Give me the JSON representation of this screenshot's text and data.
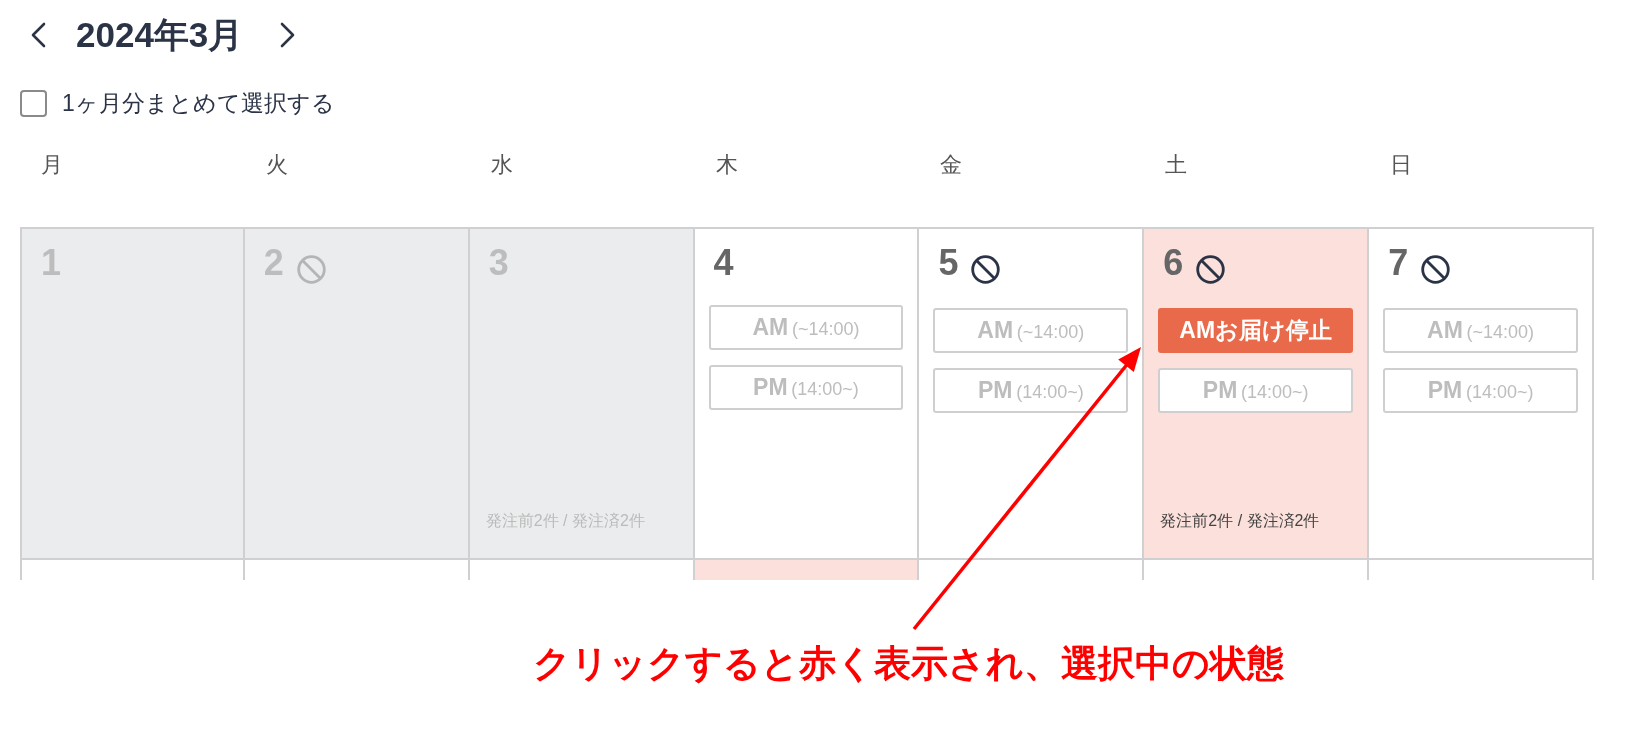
{
  "header": {
    "title": "2024年3月"
  },
  "select_month": {
    "label": "1ヶ月分まとめて選択する",
    "checked": false
  },
  "weekdays": [
    "月",
    "火",
    "水",
    "木",
    "金",
    "土",
    "日"
  ],
  "weeks": [
    {
      "days": [
        {
          "number": "1",
          "disabled": true,
          "selected": false,
          "no_delivery": false
        },
        {
          "number": "2",
          "disabled": true,
          "selected": false,
          "no_delivery": true
        },
        {
          "number": "3",
          "disabled": true,
          "selected": false,
          "no_delivery": false,
          "summary": "発注前2件 / 発注済2件"
        },
        {
          "number": "4",
          "disabled": false,
          "selected": false,
          "no_delivery": false,
          "slots": [
            {
              "label": "AM",
              "time": "(~14:00)",
              "selected": false
            },
            {
              "label": "PM",
              "time": "(14:00~)",
              "selected": false
            }
          ]
        },
        {
          "number": "5",
          "disabled": false,
          "selected": false,
          "no_delivery": true,
          "slots": [
            {
              "label": "AM",
              "time": "(~14:00)",
              "selected": false
            },
            {
              "label": "PM",
              "time": "(14:00~)",
              "selected": false
            }
          ]
        },
        {
          "number": "6",
          "disabled": false,
          "selected": true,
          "no_delivery": true,
          "slots": [
            {
              "label": "AMお届け停止",
              "selected": true
            },
            {
              "label": "PM",
              "time": "(14:00~)",
              "selected": false
            }
          ],
          "summary": "発注前2件 / 発注済2件"
        },
        {
          "number": "7",
          "disabled": false,
          "selected": false,
          "no_delivery": true,
          "slots": [
            {
              "label": "AM",
              "time": "(~14:00)",
              "selected": false
            },
            {
              "label": "PM",
              "time": "(14:00~)",
              "selected": false
            }
          ]
        }
      ]
    },
    {
      "days": [
        {
          "selected": false
        },
        {
          "selected": false
        },
        {
          "selected": false
        },
        {
          "selected": true
        },
        {
          "selected": false
        },
        {
          "selected": false
        },
        {
          "selected": false
        }
      ]
    }
  ],
  "annotation": {
    "text": "クリックすると赤く表示され、選択中の状態"
  }
}
